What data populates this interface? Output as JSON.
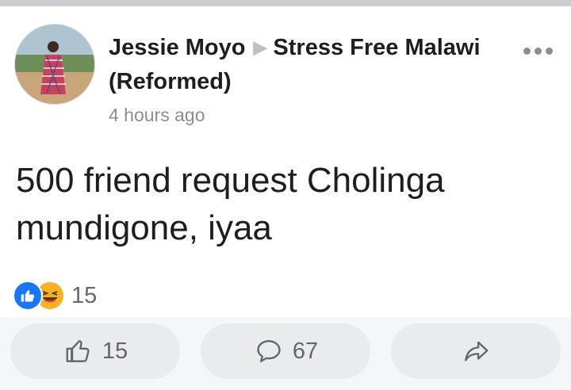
{
  "post": {
    "author": "Jessie Moyo",
    "group": "Stress Free Malawi (Reformed)",
    "timestamp": "4 hours ago",
    "text": "500 friend request Cholinga mundigone, iyaa",
    "reactions": {
      "icons": [
        "like-icon",
        "haha-icon"
      ],
      "count": "15"
    }
  },
  "actions": {
    "like_count": "15",
    "comment_count": "67"
  },
  "colors": {
    "like_blue": "#1877f2",
    "haha_yellow": "#f7b125",
    "text_primary": "#1c1e21",
    "text_secondary": "#8a8d91",
    "action_button_bg": "#eaebed"
  }
}
